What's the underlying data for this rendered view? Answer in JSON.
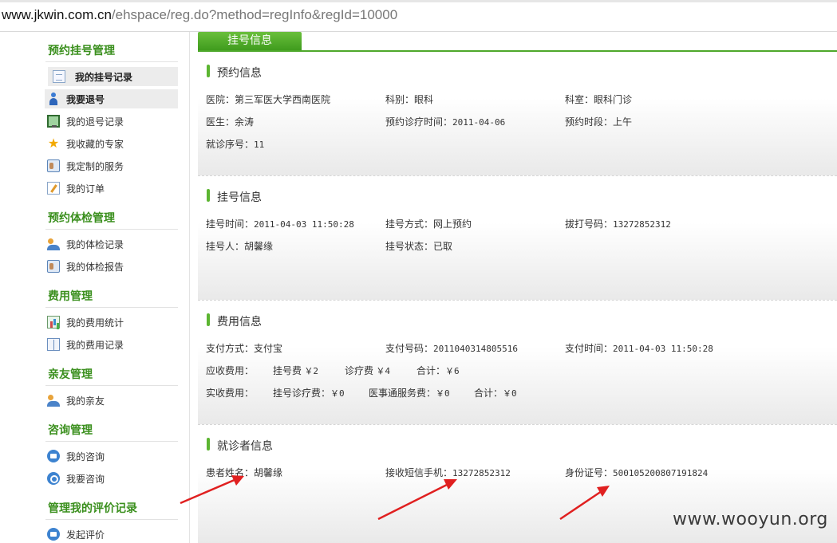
{
  "browser": {
    "url_host": "www.jkwin.com.cn",
    "url_path": "/ehspace/reg.do?method=regInfo&regId=10000"
  },
  "sidebar": {
    "sections": [
      {
        "title": "预约挂号管理",
        "items": [
          {
            "label": "我的挂号记录",
            "icon": "note-icon",
            "state": "selected-sub"
          },
          {
            "label": "我要退号",
            "icon": "person-icon",
            "state": "active"
          },
          {
            "label": "我的退号记录",
            "icon": "monitor-icon"
          },
          {
            "label": "我收藏的专家",
            "icon": "star-icon"
          },
          {
            "label": "我定制的服务",
            "icon": "id-card-icon"
          },
          {
            "label": "我的订单",
            "icon": "edit-icon"
          }
        ]
      },
      {
        "title": "预约体检管理",
        "items": [
          {
            "label": "我的体检记录",
            "icon": "people-icon"
          },
          {
            "label": "我的体检报告",
            "icon": "id-card-icon"
          }
        ]
      },
      {
        "title": "费用管理",
        "items": [
          {
            "label": "我的费用统计",
            "icon": "chart-icon"
          },
          {
            "label": "我的费用记录",
            "icon": "book-icon"
          }
        ]
      },
      {
        "title": "亲友管理",
        "items": [
          {
            "label": "我的亲友",
            "icon": "people-icon"
          }
        ]
      },
      {
        "title": "咨询管理",
        "items": [
          {
            "label": "我的咨询",
            "icon": "chat-icon"
          },
          {
            "label": "我要咨询",
            "icon": "search-icon"
          }
        ]
      },
      {
        "title": "管理我的评价记录",
        "items": [
          {
            "label": "发起评价",
            "icon": "chat-icon"
          }
        ]
      }
    ]
  },
  "main": {
    "tab_label": "挂号信息",
    "appointment": {
      "title": "预约信息",
      "hospital": "医院：第三军医大学西南医院",
      "department": "科别：眼科",
      "clinic": "科室：眼科门诊",
      "doctor": "医生：余涛",
      "visit_date_label": "预约诊疗时间：",
      "visit_date": "2011-04-06",
      "time_slot": "预约时段：上午",
      "queue_label": "就诊序号：",
      "queue_no": "11"
    },
    "registration": {
      "title": "挂号信息",
      "reg_time_label": "挂号时间：",
      "reg_time": "2011-04-03 11:50:28",
      "method": "挂号方式：网上预约",
      "phone_label": "拔打号码：",
      "phone": "13272852312",
      "registrant": "挂号人：胡馨缘",
      "status": "挂号状态：已取"
    },
    "fees": {
      "title": "费用信息",
      "pay_method": "支付方式：支付宝",
      "pay_no_label": "支付号码：",
      "pay_no": "2011040314805516",
      "pay_time_label": "支付时间：",
      "pay_time": "2011-04-03 11:50:28",
      "receivable_label": "应收费用：",
      "reg_fee_label": "挂号费 ",
      "reg_fee": "￥2",
      "diag_fee_label": "诊疗费 ",
      "diag_fee": "￥4",
      "total1_label": "合计：",
      "total1": "￥6",
      "actual_label": "实收费用：",
      "actual_diag_label": "挂号诊疗费：",
      "actual_diag": "￥0",
      "service_label": "医事通服务费：",
      "service": "￥0",
      "total2_label": "合计：",
      "total2": "￥0"
    },
    "patient": {
      "title": "就诊者信息",
      "name": "患者姓名：胡馨缘",
      "sms_label": "接收短信手机：",
      "sms_phone": "13272852312",
      "id_label": "身份证号：",
      "id_no": "500105200807191824"
    }
  },
  "watermark": "www.wooyun.org",
  "colors": {
    "accent_green": "#3a8f1d",
    "tab_green": "#4ea82b",
    "arrow_red": "#e02020"
  }
}
